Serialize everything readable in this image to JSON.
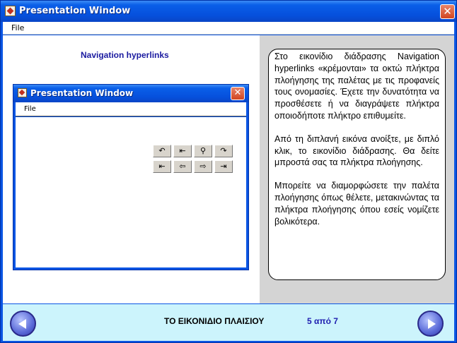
{
  "window": {
    "title": "Presentation Window",
    "close_glyph": "✕"
  },
  "menubar": {
    "items": [
      {
        "label": "File"
      }
    ]
  },
  "left": {
    "heading": "Navigation hyperlinks",
    "inner_window": {
      "title": "Presentation Window",
      "close_glyph": "✕",
      "menu_label": "File",
      "nav_buttons": [
        {
          "name": "back-icon",
          "glyph": "↶"
        },
        {
          "name": "recent-pages-icon",
          "glyph": "⇤"
        },
        {
          "name": "find-icon",
          "glyph": "⚲"
        },
        {
          "name": "return-icon",
          "glyph": "↷"
        },
        {
          "name": "first-page-icon",
          "glyph": "⇤"
        },
        {
          "name": "previous-icon",
          "glyph": "⇦"
        },
        {
          "name": "next-icon",
          "glyph": "⇨"
        },
        {
          "name": "last-page-icon",
          "glyph": "⇥"
        }
      ]
    }
  },
  "right": {
    "paragraphs": [
      "Στο εικονίδιο διάδρασης Navigation hyperlinks «κρέμονται» τα οκτώ πλήκτρα πλοήγησης της παλέτας με τις προφανείς τους ονομασίες. Έχετε την δυνατότητα να προσθέσετε ή να διαγράψετε πλήκτρα οποιοδήποτε πλήκτρο επιθυμείτε.",
      "Από τη διπλανή εικόνα ανοίξτε, με διπλό κλικ, το εικονίδιο διάδρασης. Θα δείτε μπροστά σας τα πλήκτρα πλοήγησης.",
      "Μπορείτε να διαμορφώσετε την παλέτα πλοήγησης όπως θέλετε, μετακινώντας τα πλήκτρα πλοήγησης όπου εσείς νομίζετε βολικότερα."
    ]
  },
  "footer": {
    "section_title": "ΤΟ ΕΙΚΟΝΙΔΙΟ ΠΛΑΙΣΙΟΥ",
    "page_counter": "5 από 7"
  },
  "colors": {
    "accent": "#0a55e3",
    "heading": "#1a1aa0",
    "footer_bg": "#ccf4fc",
    "counter": "#2020b0"
  }
}
